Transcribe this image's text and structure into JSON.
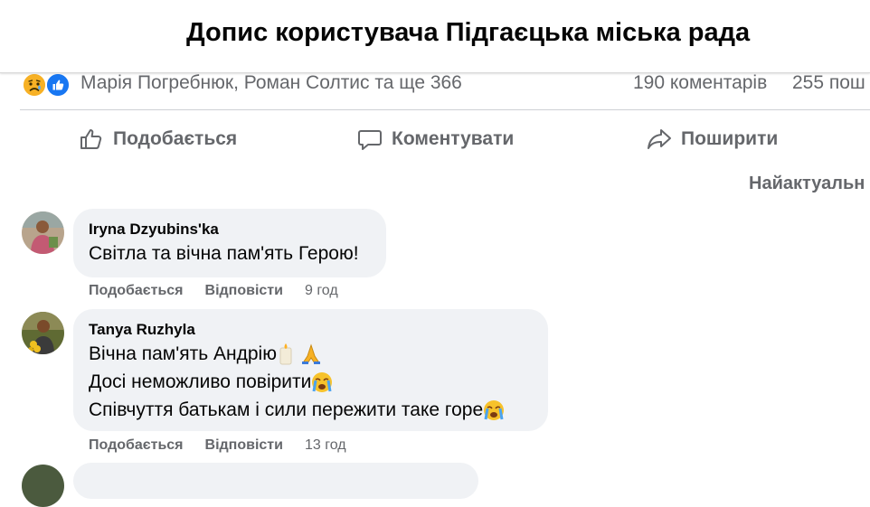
{
  "header": {
    "title": "Допис користувача Підгаєцька міська рада"
  },
  "post_stats": {
    "reactions": [
      "sad-reaction",
      "like-reaction"
    ],
    "reactors_text": "Марія Погребнюк, Роман Солтис та ще 366",
    "comments_text": "190 коментарів",
    "shares_text": "255 пош"
  },
  "actions": {
    "like_label": "Подобається",
    "comment_label": "Коментувати",
    "share_label": "Поширити"
  },
  "sort": {
    "label": "Найактуальн"
  },
  "comments": [
    {
      "author": "Iryna Dzyubins'ka",
      "lines": [
        "Світла та вічна пам'ять Герою!"
      ],
      "like_label": "Подобається",
      "reply_label": "Відповісти",
      "time": "9 год"
    },
    {
      "author": "Tanya Ruzhyla",
      "lines": [
        "Вічна пам'ять Андрію",
        "Досі неможливо повірити",
        "Співчуття батькам і сили пережити таке горе"
      ],
      "emojis": [
        "candle-emoji",
        "pray-emoji",
        "crying-face-emoji",
        "crying-face-emoji"
      ],
      "like_label": "Подобається",
      "reply_label": "Відповісти",
      "time": "13 год"
    }
  ],
  "colors": {
    "secondary_text": "#65676b",
    "bubble_bg": "#f0f2f5",
    "brand_blue": "#1877f2",
    "reaction_yellow": "#f7b125"
  }
}
